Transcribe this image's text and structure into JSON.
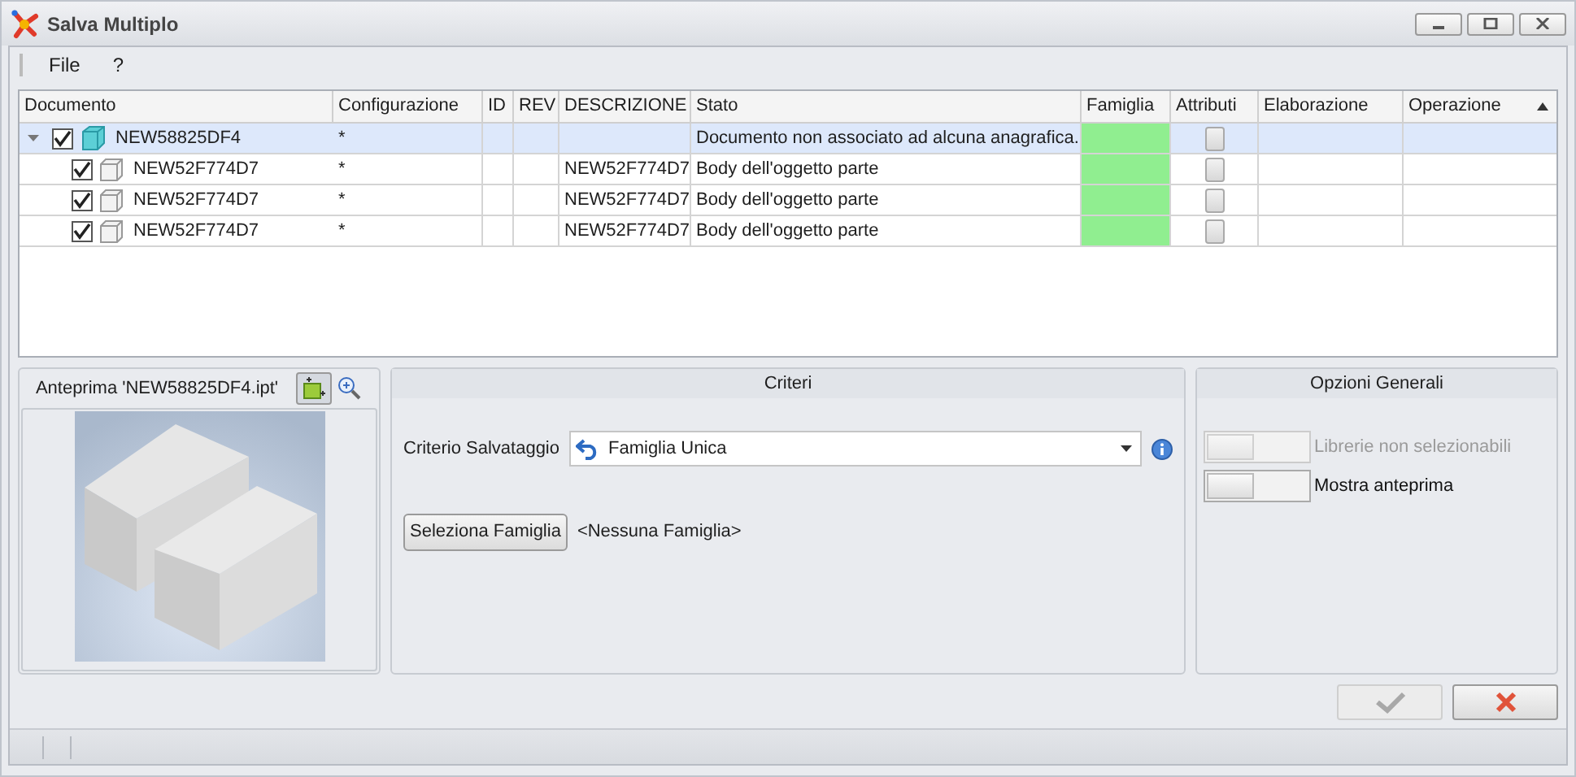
{
  "window": {
    "title": "Salva Multiplo"
  },
  "menu": [
    {
      "label": "File"
    },
    {
      "label": "?"
    }
  ],
  "table": {
    "columns": [
      {
        "label": "Documento"
      },
      {
        "label": "Configurazione"
      },
      {
        "label": "ID"
      },
      {
        "label": "REV"
      },
      {
        "label": "DESCRIZIONE"
      },
      {
        "label": "Stato"
      },
      {
        "label": "Famiglia"
      },
      {
        "label": "Attributi"
      },
      {
        "label": "Elaborazione"
      },
      {
        "label": "Operazione",
        "sorted": true
      }
    ],
    "rows": [
      {
        "kind": "assembly",
        "name": "NEW58825DF4",
        "checked": true,
        "selected": true,
        "expanded": true,
        "configurazione": "*",
        "stato": "Documento non associato ad alcuna anagrafica.",
        "color": "#90ee90",
        "children": [
          {
            "kind": "part",
            "name": "NEW52F774D7",
            "checked": true,
            "selected": false,
            "configurazione": "*",
            "descrizione": "NEW52F774D7",
            "stato": "Body dell'oggetto parte",
            "color": "#90ee90"
          },
          {
            "kind": "part",
            "name": "NEW52F774D7",
            "checked": true,
            "selected": false,
            "configurazione": "*",
            "descrizione": "NEW52F774D7",
            "stato": "Body dell'oggetto parte",
            "color": "#90ee90"
          },
          {
            "kind": "part",
            "name": "NEW52F774D7",
            "checked": true,
            "selected": false,
            "configurazione": "*",
            "descrizione": "NEW52F774D7",
            "stato": "Body dell'oggetto parte",
            "color": "#90ee90"
          }
        ]
      }
    ]
  },
  "preview": {
    "title": "Anteprima 'NEW58825DF4.ipt'",
    "kind": "picture"
  },
  "criteri": {
    "title": "Criteri",
    "criterio_label": "Criterio Salvataggio",
    "criterio_value": "Famiglia Unica",
    "select_button": "Seleziona Famiglia",
    "famiglia": "<Nessuna Famiglia>"
  },
  "opzioni": {
    "title": "Opzioni Generali",
    "toggles": [
      {
        "label": "Librerie non selezionabili",
        "on": false,
        "disabled": true
      },
      {
        "label": "Mostra anteprima",
        "on": false,
        "disabled": false
      }
    ]
  },
  "buttons": [
    {
      "kind": "ok",
      "disabled": true
    },
    {
      "kind": "cancel",
      "disabled": false
    }
  ]
}
